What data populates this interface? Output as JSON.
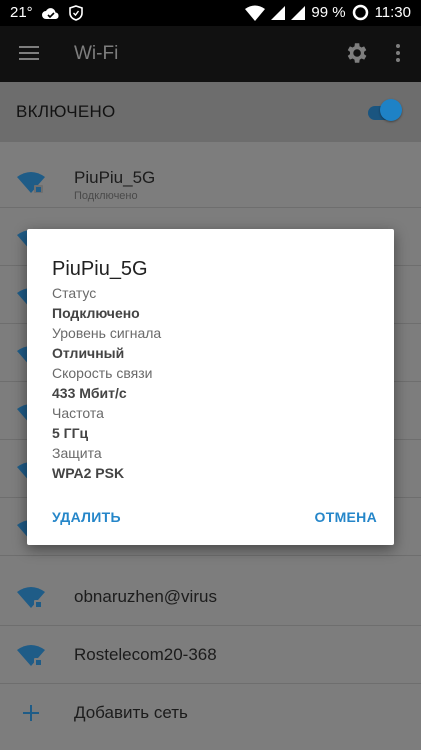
{
  "status_bar": {
    "temperature": "21°",
    "battery": "99 %",
    "time": "11:30"
  },
  "app_bar": {
    "title": "Wi-Fi"
  },
  "wifi_toggle": {
    "label": "ВКЛЮЧЕНО",
    "state": "on"
  },
  "networks": [
    {
      "name": "PiuPiu_5G",
      "status": "Подключено"
    },
    {
      "name": "obnaruzhen@virus"
    },
    {
      "name": "Rostelecom20-368"
    }
  ],
  "add_network": {
    "label": "Добавить сеть"
  },
  "dialog": {
    "title": "PiuPiu_5G",
    "details": [
      {
        "label": "Статус",
        "value": "Подключено"
      },
      {
        "label": "Уровень сигнала",
        "value": "Отличный"
      },
      {
        "label": "Скорость связи",
        "value": "433 Мбит/с"
      },
      {
        "label": "Частота",
        "value": "5 ГГц"
      },
      {
        "label": "Защита",
        "value": "WPA2 PSK"
      }
    ],
    "forget_button": "УДАЛИТЬ",
    "cancel_button": "ОТМЕНА"
  },
  "colors": {
    "accent": "#2586c9",
    "wifi_icon": "#1f5c87",
    "scrim": "#7d7d7d"
  }
}
